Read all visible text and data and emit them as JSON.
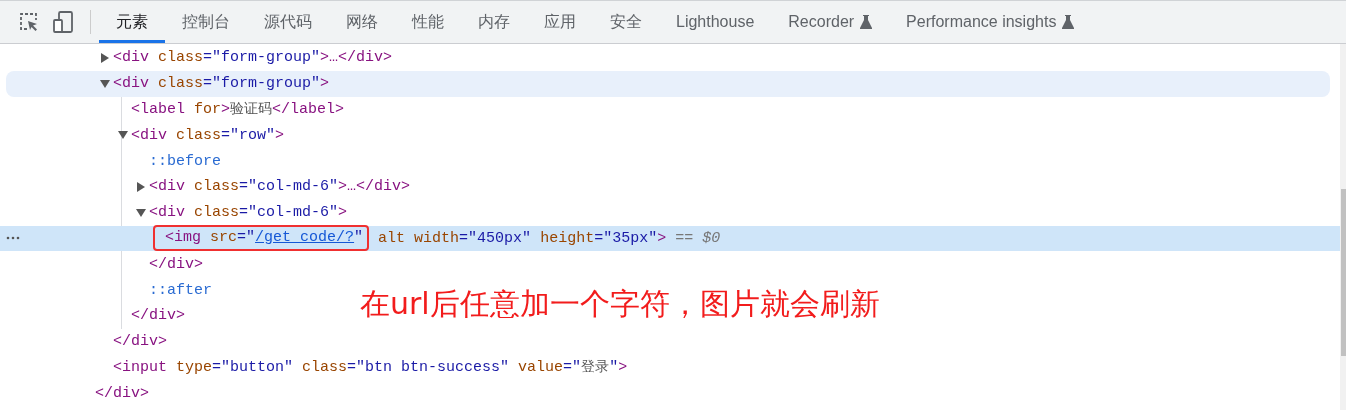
{
  "toolbar": {
    "tabs": [
      {
        "label": "元素",
        "selected": true,
        "experimental": false
      },
      {
        "label": "控制台",
        "selected": false,
        "experimental": false
      },
      {
        "label": "源代码",
        "selected": false,
        "experimental": false
      },
      {
        "label": "网络",
        "selected": false,
        "experimental": false
      },
      {
        "label": "性能",
        "selected": false,
        "experimental": false
      },
      {
        "label": "内存",
        "selected": false,
        "experimental": false
      },
      {
        "label": "应用",
        "selected": false,
        "experimental": false
      },
      {
        "label": "安全",
        "selected": false,
        "experimental": false
      },
      {
        "label": "Lighthouse",
        "selected": false,
        "experimental": false
      },
      {
        "label": "Recorder",
        "selected": false,
        "experimental": true
      },
      {
        "label": "Performance insights",
        "selected": false,
        "experimental": true
      }
    ]
  },
  "dom": {
    "close": [
      {
        "kind": "tag",
        "t": "</div>"
      }
    ],
    "children": [
      {
        "expanded": false,
        "hovered": false,
        "selected": false,
        "segments": [
          {
            "kind": "tag",
            "t": "<div "
          },
          {
            "kind": "attr",
            "t": "class"
          },
          {
            "kind": "value",
            "t": "=\"form-group\""
          },
          {
            "kind": "tag",
            "t": ">…</div>"
          }
        ]
      },
      {
        "expanded": true,
        "hovered": true,
        "selected": false,
        "segments": [
          {
            "kind": "tag",
            "t": "<div "
          },
          {
            "kind": "attr",
            "t": "class"
          },
          {
            "kind": "value",
            "t": "=\"form-group\""
          },
          {
            "kind": "tag",
            "t": ">"
          }
        ],
        "close": [
          {
            "kind": "tag",
            "t": "</div>"
          }
        ],
        "children": [
          {
            "hovered": false,
            "selected": false,
            "segments": [
              {
                "kind": "tag",
                "t": "<label "
              },
              {
                "kind": "attr",
                "t": "for"
              },
              {
                "kind": "tag",
                "t": ">"
              },
              {
                "kind": "text",
                "t": "验证码"
              },
              {
                "kind": "tag",
                "t": "</label>"
              }
            ]
          },
          {
            "expanded": true,
            "hovered": false,
            "selected": false,
            "segments": [
              {
                "kind": "tag",
                "t": "<div "
              },
              {
                "kind": "attr",
                "t": "class"
              },
              {
                "kind": "value",
                "t": "=\"row\""
              },
              {
                "kind": "tag",
                "t": ">"
              }
            ],
            "close": [
              {
                "kind": "tag",
                "t": "</div>"
              }
            ],
            "children": [
              {
                "hovered": false,
                "selected": false,
                "segments": [
                  {
                    "kind": "pseudo",
                    "t": "::before"
                  }
                ]
              },
              {
                "expanded": false,
                "hovered": false,
                "selected": false,
                "segments": [
                  {
                    "kind": "tag",
                    "t": "<div "
                  },
                  {
                    "kind": "attr",
                    "t": "class"
                  },
                  {
                    "kind": "value",
                    "t": "=\"col-md-6\""
                  },
                  {
                    "kind": "tag",
                    "t": ">…</div>"
                  }
                ]
              },
              {
                "expanded": true,
                "hovered": false,
                "selected": false,
                "segments": [
                  {
                    "kind": "tag",
                    "t": "<div "
                  },
                  {
                    "kind": "attr",
                    "t": "class"
                  },
                  {
                    "kind": "value",
                    "t": "=\"col-md-6\""
                  },
                  {
                    "kind": "tag",
                    "t": ">"
                  }
                ],
                "close": [
                  {
                    "kind": "tag",
                    "t": "</div>"
                  }
                ],
                "children": [
                  {
                    "hovered": false,
                    "selected": true,
                    "boxed_segments": [
                      {
                        "kind": "tag",
                        "t": "<img "
                      },
                      {
                        "kind": "attr",
                        "t": "src"
                      },
                      {
                        "kind": "value",
                        "t": "=\""
                      },
                      {
                        "kind": "link",
                        "t": "/get_code/?"
                      },
                      {
                        "kind": "value",
                        "t": "\""
                      }
                    ],
                    "segments": [
                      {
                        "kind": "attr",
                        "t": " alt width"
                      },
                      {
                        "kind": "value",
                        "t": "=\"450px\""
                      },
                      {
                        "kind": "attr",
                        "t": " height"
                      },
                      {
                        "kind": "value",
                        "t": "=\"35px\""
                      },
                      {
                        "kind": "tag",
                        "t": ">"
                      },
                      {
                        "kind": "dim",
                        "t": " == $0"
                      }
                    ]
                  }
                ]
              },
              {
                "hovered": false,
                "selected": false,
                "segments": [
                  {
                    "kind": "pseudo",
                    "t": "::after"
                  }
                ]
              }
            ]
          }
        ]
      },
      {
        "hovered": false,
        "selected": false,
        "segments": [
          {
            "kind": "tag",
            "t": "<input "
          },
          {
            "kind": "attr",
            "t": "type"
          },
          {
            "kind": "value",
            "t": "=\"button\""
          },
          {
            "kind": "attr",
            "t": " class"
          },
          {
            "kind": "value",
            "t": "=\"btn btn-success\""
          },
          {
            "kind": "attr",
            "t": " value"
          },
          {
            "kind": "value",
            "t": "=\""
          },
          {
            "kind": "text",
            "t": "登录"
          },
          {
            "kind": "value",
            "t": "\""
          },
          {
            "kind": "tag",
            "t": ">"
          }
        ]
      }
    ]
  },
  "annotation": {
    "text": "在url后任意加一个字符，图片就会刷新"
  }
}
